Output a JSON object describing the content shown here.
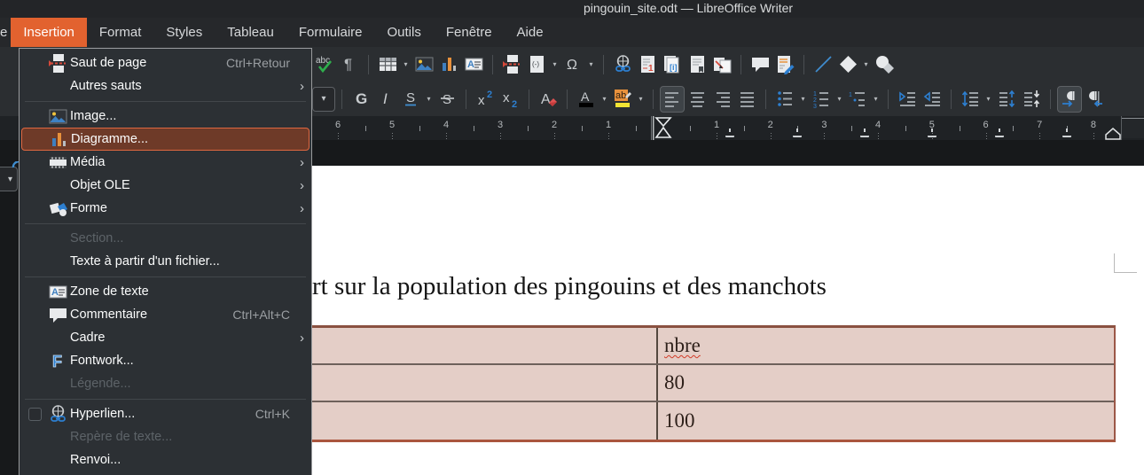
{
  "window": {
    "title": "pingouin_site.odt — LibreOffice Writer"
  },
  "menubar": {
    "partial_left_item": "e",
    "items": [
      {
        "label": "Insertion",
        "active": true
      },
      {
        "label": "Format"
      },
      {
        "label": "Styles"
      },
      {
        "label": "Tableau"
      },
      {
        "label": "Formulaire"
      },
      {
        "label": "Outils"
      },
      {
        "label": "Fenêtre"
      },
      {
        "label": "Aide"
      }
    ]
  },
  "insert_menu": {
    "items": [
      {
        "label": "Saut de page",
        "icon": "page-break-icon",
        "shortcut": "Ctrl+Retour"
      },
      {
        "label": "Autres sauts",
        "submenu": true
      },
      {
        "type": "sep"
      },
      {
        "label": "Image...",
        "icon": "image-icon"
      },
      {
        "label": "Diagramme...",
        "icon": "chart-icon",
        "highlighted": true
      },
      {
        "label": "Média",
        "icon": "media-icon",
        "submenu": true
      },
      {
        "label": "Objet OLE",
        "submenu": true
      },
      {
        "label": "Forme",
        "icon": "shape-icon",
        "submenu": true
      },
      {
        "type": "sep"
      },
      {
        "label": "Section...",
        "disabled": true
      },
      {
        "label": "Texte à partir d'un fichier..."
      },
      {
        "type": "sep"
      },
      {
        "label": "Zone de texte",
        "icon": "textbox-icon"
      },
      {
        "label": "Commentaire",
        "icon": "comment-icon",
        "shortcut": "Ctrl+Alt+C"
      },
      {
        "label": "Cadre",
        "submenu": true
      },
      {
        "label": "Fontwork...",
        "icon": "fontwork-icon"
      },
      {
        "label": "Légende...",
        "disabled": true
      },
      {
        "type": "sep"
      },
      {
        "label": "Hyperlien...",
        "icon": "hyperlink-icon",
        "shortcut": "Ctrl+K",
        "checkbox": true
      },
      {
        "label": "Repère de texte...",
        "disabled": true
      },
      {
        "label": "Renvoi..."
      },
      {
        "type": "sep"
      }
    ]
  },
  "toolbar_standard": {
    "buttons": [
      {
        "name": "spellcheck-button",
        "icon": "spellcheck-icon"
      },
      {
        "name": "formatting-marks-button",
        "icon": "pilcrow-icon"
      },
      {
        "type": "sep"
      },
      {
        "name": "insert-table-button",
        "icon": "table-icon",
        "dropdown": true
      },
      {
        "name": "insert-image-button",
        "icon": "image-icon"
      },
      {
        "name": "insert-chart-button",
        "icon": "chart-icon"
      },
      {
        "name": "insert-textbox-button",
        "icon": "textbox-icon"
      },
      {
        "type": "sep"
      },
      {
        "name": "insert-page-break-button",
        "icon": "page-break-icon"
      },
      {
        "name": "insert-field-button",
        "icon": "field-icon",
        "dropdown": true
      },
      {
        "name": "insert-special-character-button",
        "icon": "omega-icon",
        "dropdown": true
      },
      {
        "type": "sep"
      },
      {
        "name": "insert-hyperlink-button",
        "icon": "hyperlink-icon"
      },
      {
        "name": "insert-footnote-button",
        "icon": "footnote-icon"
      },
      {
        "name": "insert-endnote-button",
        "icon": "endnote-icon"
      },
      {
        "name": "insert-bookmark-button",
        "icon": "bookmark-icon"
      },
      {
        "name": "insert-cross-reference-button",
        "icon": "cross-reference-icon"
      },
      {
        "type": "sep"
      },
      {
        "name": "insert-comment-button",
        "icon": "comment-icon"
      },
      {
        "name": "track-changes-button",
        "icon": "track-changes-icon"
      },
      {
        "type": "sep"
      },
      {
        "name": "insert-line-button",
        "icon": "line-icon"
      },
      {
        "name": "basic-shapes-button",
        "icon": "diamond-icon",
        "dropdown": true
      },
      {
        "name": "symbol-shapes-button",
        "icon": "symbol-shapes-icon"
      }
    ]
  },
  "toolbar_formatting": {
    "buttons": [
      {
        "type": "combo-frag"
      },
      {
        "type": "sep"
      },
      {
        "name": "bold-button",
        "icon": "bold-icon"
      },
      {
        "name": "italic-button",
        "icon": "italic-icon"
      },
      {
        "name": "underline-button",
        "icon": "underline-icon",
        "dropdown": true
      },
      {
        "name": "strikethrough-button",
        "icon": "strikethrough-icon"
      },
      {
        "type": "sep"
      },
      {
        "name": "superscript-button",
        "icon": "superscript-icon"
      },
      {
        "name": "subscript-button",
        "icon": "subscript-icon"
      },
      {
        "type": "sep"
      },
      {
        "name": "clear-formatting-button",
        "icon": "clear-formatting-icon"
      },
      {
        "type": "sep"
      },
      {
        "name": "font-color-button",
        "icon": "font-color-icon",
        "dropdown": true
      },
      {
        "name": "highlight-color-button",
        "icon": "highlight-icon",
        "dropdown": true
      },
      {
        "type": "sep"
      },
      {
        "name": "align-left-button",
        "icon": "align-left-icon",
        "pressed": true
      },
      {
        "name": "align-center-button",
        "icon": "align-center-icon"
      },
      {
        "name": "align-right-button",
        "icon": "align-right-icon"
      },
      {
        "name": "justify-button",
        "icon": "justify-icon"
      },
      {
        "type": "sep"
      },
      {
        "name": "bullet-list-button",
        "icon": "bullets-icon",
        "dropdown": true
      },
      {
        "name": "numbered-list-button",
        "icon": "numbering-icon",
        "dropdown": true
      },
      {
        "name": "outline-list-button",
        "icon": "outline-icon",
        "dropdown": true
      },
      {
        "type": "sep"
      },
      {
        "name": "increase-indent-button",
        "icon": "indent-increase-icon"
      },
      {
        "name": "decrease-indent-button",
        "icon": "indent-decrease-icon"
      },
      {
        "type": "sep"
      },
      {
        "name": "line-spacing-button",
        "icon": "line-spacing-icon",
        "dropdown": true
      },
      {
        "name": "increase-paragraph-spacing-button",
        "icon": "space-increase-icon"
      },
      {
        "name": "decrease-paragraph-spacing-button",
        "icon": "space-decrease-icon"
      },
      {
        "type": "sep"
      },
      {
        "name": "left-to-right-button",
        "icon": "ltr-icon",
        "pressed": true
      },
      {
        "name": "right-to-left-button",
        "icon": "rtl-icon"
      }
    ]
  },
  "ruler": {
    "left_numbers": [
      "6",
      "5",
      "4",
      "3",
      "2",
      "1"
    ],
    "right_numbers": [
      "1",
      "2",
      "3",
      "4",
      "5",
      "6",
      "7",
      "8"
    ]
  },
  "document": {
    "heading_visible_text": "rt sur la population des pingouins et des manchots",
    "table": {
      "header": [
        "",
        "nbre"
      ],
      "rows": [
        [
          "",
          "80"
        ],
        [
          "",
          "100"
        ]
      ]
    }
  },
  "colors": {
    "accent_orange": "#e2622f",
    "menu_highlight_fill": "#6e3a28",
    "menu_highlight_border": "#de6740",
    "table_cell_bg": "#e4cec7",
    "table_border_brown": "#8a5140",
    "page_bg": "#ffffff",
    "dark_chrome": "#26282b"
  }
}
